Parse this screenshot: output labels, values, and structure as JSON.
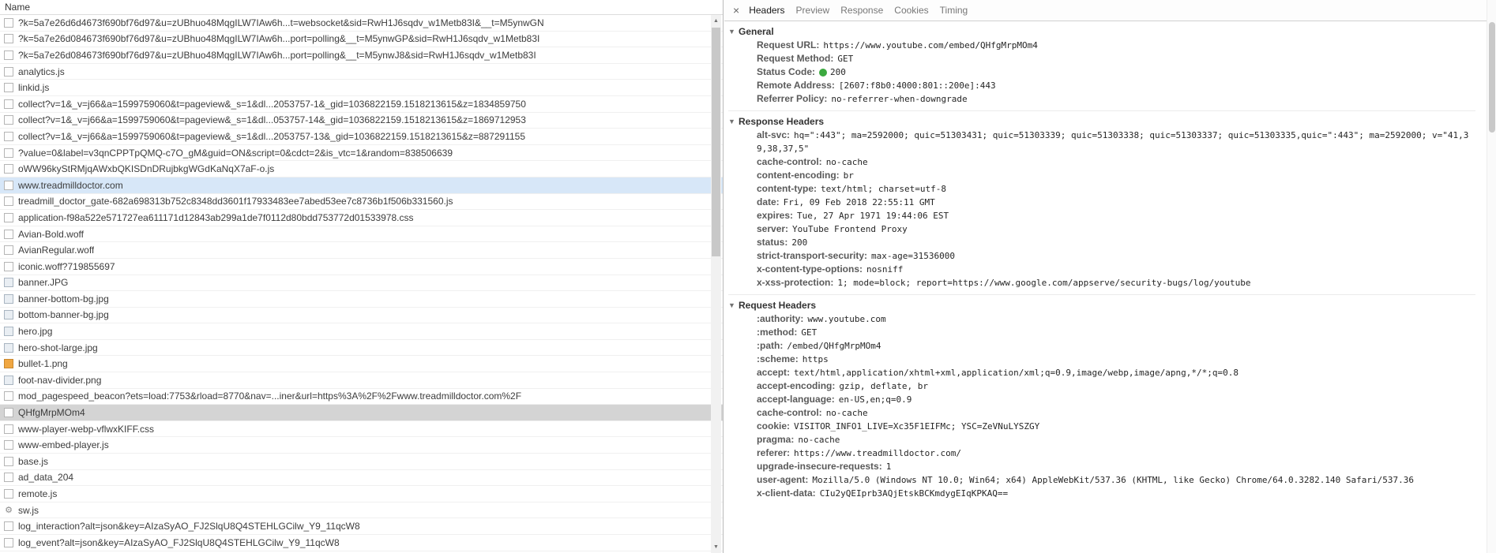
{
  "colors": {
    "selected_blue": "#d7e7f8",
    "selected_gray": "#d4d4d4",
    "status_green": "#3ba93f"
  },
  "icons": {
    "scroll_up": "▲",
    "scroll_down": "▼",
    "disclosure": "▼",
    "gear": "⚙"
  },
  "network_panel": {
    "column_header": "Name",
    "rows": [
      {
        "label": "?k=5a7e26d6d4673f690bf76d97&u=zUBhuo48MqgILW7IAw6h...t=websocket&sid=RwH1J6sqdv_w1Metb83I&__t=M5ynwGN",
        "icon": "file",
        "state": "normal"
      },
      {
        "label": "?k=5a7e26d084673f690bf76d97&u=zUBhuo48MqgILW7IAw6h...port=polling&__t=M5ynwGP&sid=RwH1J6sqdv_w1Metb83I",
        "icon": "file",
        "state": "normal"
      },
      {
        "label": "?k=5a7e26d084673f690bf76d97&u=zUBhuo48MqgILW7IAw6h...port=polling&__t=M5ynwJ8&sid=RwH1J6sqdv_w1Metb83I",
        "icon": "file",
        "state": "normal"
      },
      {
        "label": "analytics.js",
        "icon": "file",
        "state": "normal"
      },
      {
        "label": "linkid.js",
        "icon": "file",
        "state": "normal"
      },
      {
        "label": "collect?v=1&_v=j66&a=1599759060&t=pageview&_s=1&dl...2053757-1&_gid=1036822159.1518213615&z=1834859750",
        "icon": "file",
        "state": "normal"
      },
      {
        "label": "collect?v=1&_v=j66&a=1599759060&t=pageview&_s=1&dl...053757-14&_gid=1036822159.1518213615&z=1869712953",
        "icon": "file",
        "state": "normal"
      },
      {
        "label": "collect?v=1&_v=j66&a=1599759060&t=pageview&_s=1&dl...2053757-13&_gid=1036822159.1518213615&z=887291155",
        "icon": "file",
        "state": "normal"
      },
      {
        "label": "?value=0&label=v3qnCPPTpQMQ-c7O_gM&guid=ON&script=0&cdct=2&is_vtc=1&random=838506639",
        "icon": "file",
        "state": "normal"
      },
      {
        "label": "oWW96kyStRMjqAWxbQKISDnDRujbkgWGdKaNqX7aF-o.js",
        "icon": "file",
        "state": "normal"
      },
      {
        "label": "www.treadmilldoctor.com",
        "icon": "file",
        "state": "highlighted"
      },
      {
        "label": "treadmill_doctor_gate-682a698313b752c8348dd3601f17933483ee7abed53ee7c8736b1f506b331560.js",
        "icon": "file",
        "state": "normal"
      },
      {
        "label": "application-f98a522e571727ea611171d12843ab299a1de7f0112d80bdd753772d01533978.css",
        "icon": "file",
        "state": "normal"
      },
      {
        "label": "Avian-Bold.woff",
        "icon": "file",
        "state": "normal"
      },
      {
        "label": "AvianRegular.woff",
        "icon": "file",
        "state": "normal"
      },
      {
        "label": "iconic.woff?719855697",
        "icon": "file",
        "state": "normal"
      },
      {
        "label": "banner.JPG",
        "icon": "image",
        "state": "normal"
      },
      {
        "label": "banner-bottom-bg.jpg",
        "icon": "image",
        "state": "normal"
      },
      {
        "label": "bottom-banner-bg.jpg",
        "icon": "image",
        "state": "normal"
      },
      {
        "label": "hero.jpg",
        "icon": "image",
        "state": "normal"
      },
      {
        "label": "hero-shot-large.jpg",
        "icon": "image",
        "state": "normal"
      },
      {
        "label": "bullet-1.png",
        "icon": "image-orange",
        "state": "normal"
      },
      {
        "label": "foot-nav-divider.png",
        "icon": "image",
        "state": "normal"
      },
      {
        "label": "mod_pagespeed_beacon?ets=load:7753&rload=8770&nav=...iner&url=https%3A%2F%2Fwww.treadmilldoctor.com%2F",
        "icon": "file",
        "state": "normal"
      },
      {
        "label": "QHfgMrpMOm4",
        "icon": "file",
        "state": "selected"
      },
      {
        "label": "www-player-webp-vflwxKIFF.css",
        "icon": "file",
        "state": "normal"
      },
      {
        "label": "www-embed-player.js",
        "icon": "file",
        "state": "normal"
      },
      {
        "label": "base.js",
        "icon": "file",
        "state": "normal"
      },
      {
        "label": "ad_data_204",
        "icon": "file",
        "state": "normal"
      },
      {
        "label": "remote.js",
        "icon": "file",
        "state": "normal"
      },
      {
        "label": "sw.js",
        "icon": "gear",
        "state": "normal"
      },
      {
        "label": "log_interaction?alt=json&key=AIzaSyAO_FJ2SlqU8Q4STEHLGCilw_Y9_11qcW8",
        "icon": "file",
        "state": "normal"
      },
      {
        "label": "log_event?alt=json&key=AIzaSyAO_FJ2SlqU8Q4STEHLGCilw_Y9_11qcW8",
        "icon": "file",
        "state": "normal"
      }
    ]
  },
  "details_panel": {
    "close_label": "×",
    "tabs": [
      {
        "label": "Headers",
        "active": true
      },
      {
        "label": "Preview",
        "active": false
      },
      {
        "label": "Response",
        "active": false
      },
      {
        "label": "Cookies",
        "active": false
      },
      {
        "label": "Timing",
        "active": false
      }
    ],
    "sections": [
      {
        "title": "General",
        "items": [
          {
            "name": "Request URL:",
            "value": "https://www.youtube.com/embed/QHfgMrpMOm4"
          },
          {
            "name": "Request Method:",
            "value": "GET"
          },
          {
            "name": "Status Code:",
            "value": "200",
            "status_dot": true
          },
          {
            "name": "Remote Address:",
            "value": "[2607:f8b0:4000:801::200e]:443"
          },
          {
            "name": "Referrer Policy:",
            "value": "no-referrer-when-downgrade"
          }
        ]
      },
      {
        "title": "Response Headers",
        "items": [
          {
            "name": "alt-svc:",
            "value": "hq=\":443\"; ma=2592000; quic=51303431; quic=51303339; quic=51303338; quic=51303337; quic=51303335,quic=\":443\"; ma=2592000; v=\"41,39,38,37,5\""
          },
          {
            "name": "cache-control:",
            "value": "no-cache"
          },
          {
            "name": "content-encoding:",
            "value": "br"
          },
          {
            "name": "content-type:",
            "value": "text/html; charset=utf-8"
          },
          {
            "name": "date:",
            "value": "Fri, 09 Feb 2018 22:55:11 GMT"
          },
          {
            "name": "expires:",
            "value": "Tue, 27 Apr 1971 19:44:06 EST"
          },
          {
            "name": "server:",
            "value": "YouTube Frontend Proxy"
          },
          {
            "name": "status:",
            "value": "200"
          },
          {
            "name": "strict-transport-security:",
            "value": "max-age=31536000"
          },
          {
            "name": "x-content-type-options:",
            "value": "nosniff"
          },
          {
            "name": "x-xss-protection:",
            "value": "1; mode=block; report=https://www.google.com/appserve/security-bugs/log/youtube"
          }
        ]
      },
      {
        "title": "Request Headers",
        "items": [
          {
            "name": ":authority:",
            "value": "www.youtube.com"
          },
          {
            "name": ":method:",
            "value": "GET"
          },
          {
            "name": ":path:",
            "value": "/embed/QHfgMrpMOm4"
          },
          {
            "name": ":scheme:",
            "value": "https"
          },
          {
            "name": "accept:",
            "value": "text/html,application/xhtml+xml,application/xml;q=0.9,image/webp,image/apng,*/*;q=0.8"
          },
          {
            "name": "accept-encoding:",
            "value": "gzip, deflate, br"
          },
          {
            "name": "accept-language:",
            "value": "en-US,en;q=0.9"
          },
          {
            "name": "cache-control:",
            "value": "no-cache"
          },
          {
            "name": "cookie:",
            "value": "VISITOR_INFO1_LIVE=Xc35F1EIFMc; YSC=ZeVNuLYSZGY"
          },
          {
            "name": "pragma:",
            "value": "no-cache"
          },
          {
            "name": "referer:",
            "value": "https://www.treadmilldoctor.com/"
          },
          {
            "name": "upgrade-insecure-requests:",
            "value": "1"
          },
          {
            "name": "user-agent:",
            "value": "Mozilla/5.0 (Windows NT 10.0; Win64; x64) AppleWebKit/537.36 (KHTML, like Gecko) Chrome/64.0.3282.140 Safari/537.36"
          },
          {
            "name": "x-client-data:",
            "value": "CIu2yQEIprb3AQjEtskBCKmdygEIqKPKAQ=="
          }
        ]
      }
    ]
  }
}
